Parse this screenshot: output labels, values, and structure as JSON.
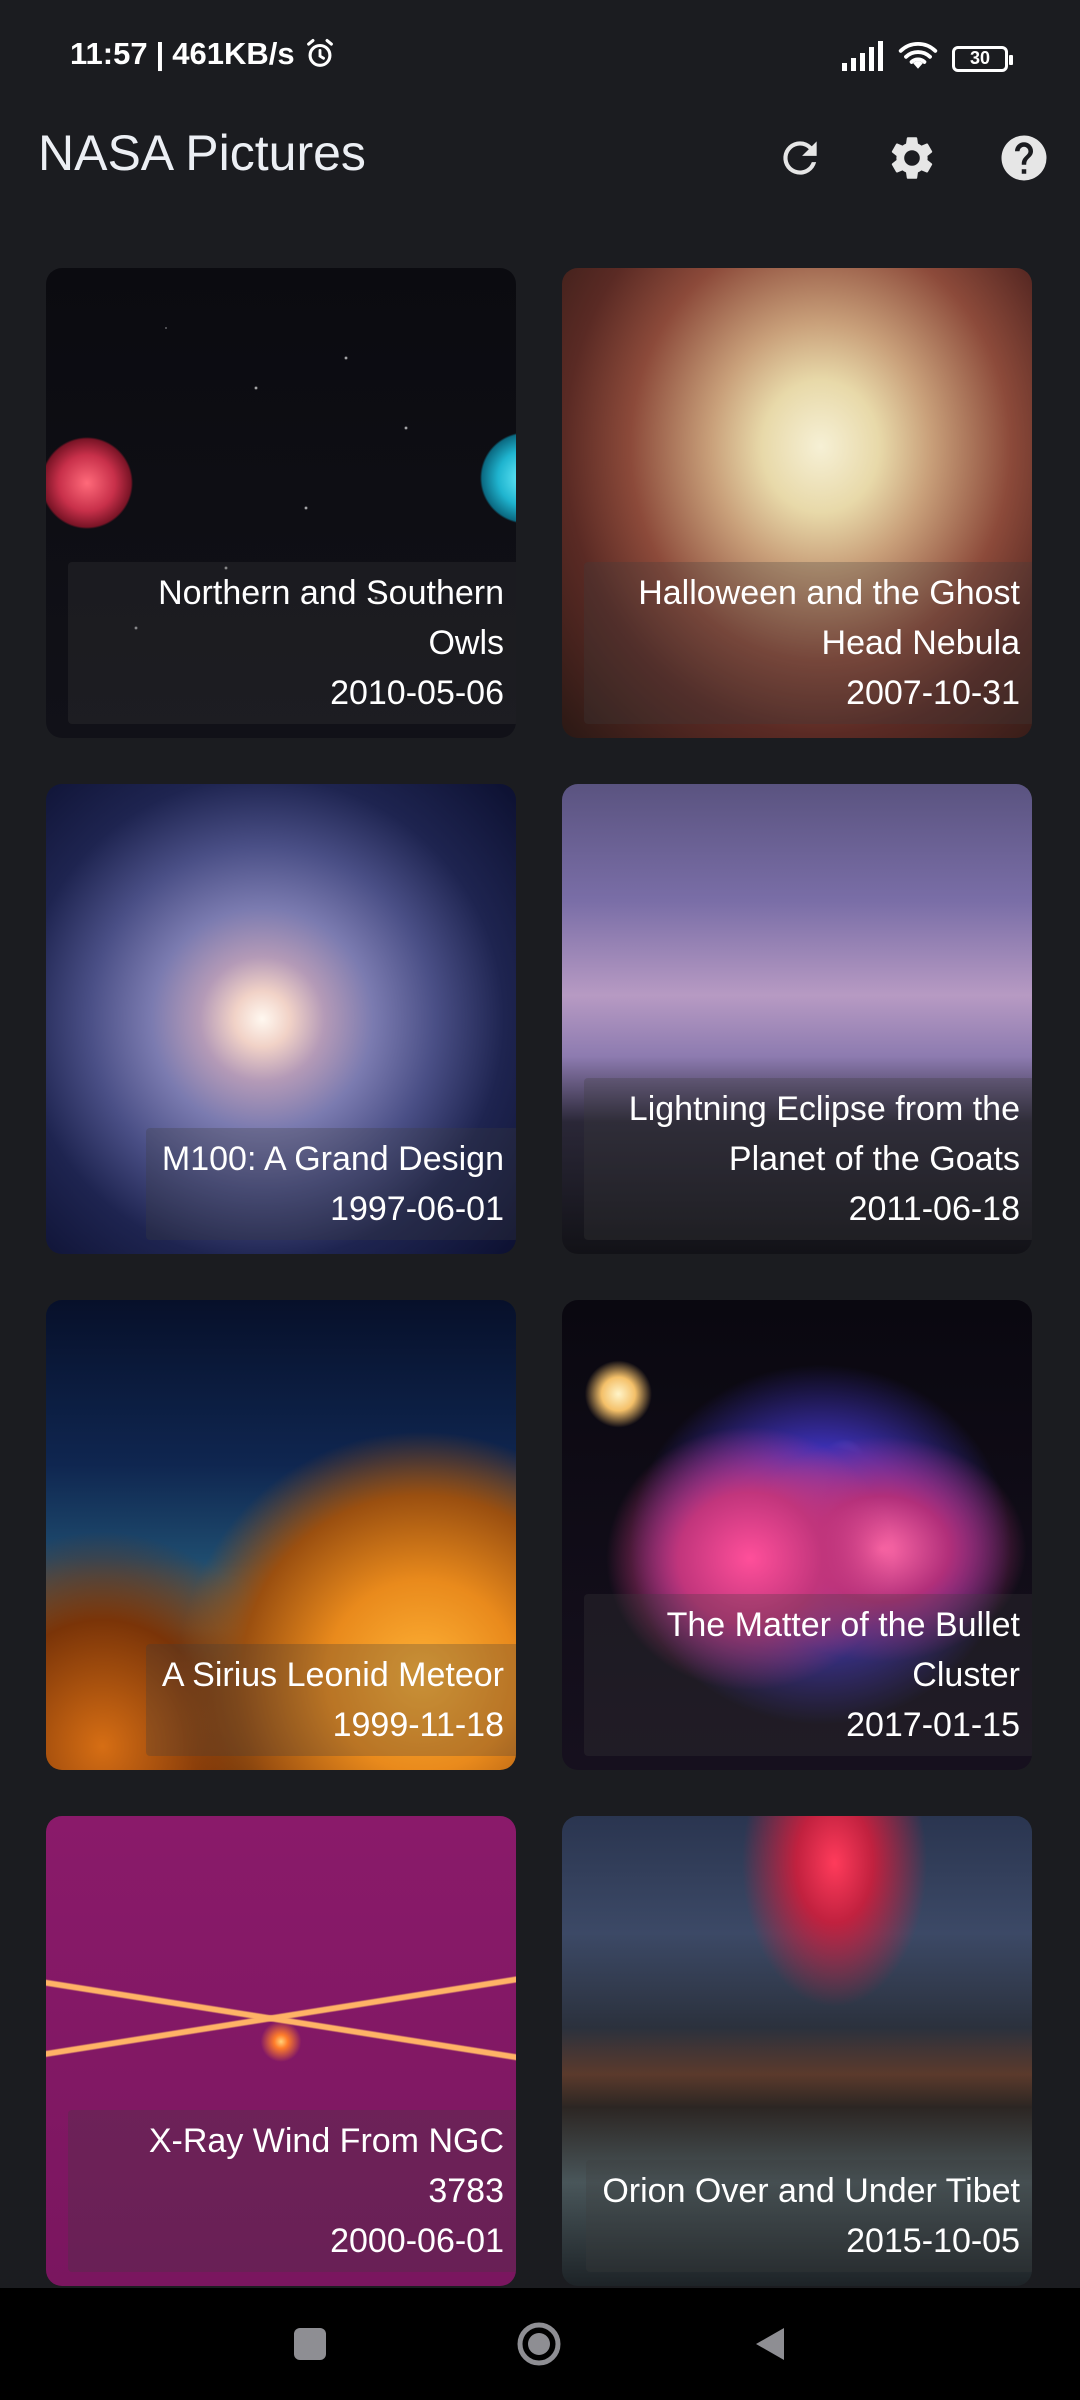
{
  "status_bar": {
    "time": "11:57",
    "network_speed": "461KB/s",
    "separator": "|",
    "battery_level": "30",
    "icons": [
      "alarm-icon",
      "signal-icon",
      "wifi-icon",
      "battery-icon"
    ]
  },
  "app_bar": {
    "title": "NASA Pictures",
    "actions": [
      {
        "name": "refresh-button",
        "icon": "refresh-icon"
      },
      {
        "name": "settings-button",
        "icon": "gear-icon"
      },
      {
        "name": "help-button",
        "icon": "help-icon"
      }
    ]
  },
  "pictures": [
    {
      "title": "Northern and Southern Owls",
      "date": "2010-05-06"
    },
    {
      "title": "Halloween and the Ghost Head Nebula",
      "date": "2007-10-31"
    },
    {
      "title": "M100: A Grand Design",
      "date": "1997-06-01"
    },
    {
      "title": "Lightning Eclipse from the Planet of the Goats",
      "date": "2011-06-18"
    },
    {
      "title": "A Sirius Leonid Meteor",
      "date": "1999-11-18"
    },
    {
      "title": "The Matter of the Bullet Cluster",
      "date": "2017-01-15"
    },
    {
      "title": "X-Ray Wind From NGC 3783",
      "date": "2000-06-01"
    },
    {
      "title": "Orion Over and Under Tibet",
      "date": "2015-10-05"
    }
  ],
  "navigation_bar": {
    "icons": [
      "recent-apps-icon",
      "home-icon",
      "back-icon"
    ]
  },
  "colors": {
    "background": "#1b1c20",
    "text": "#ffffff",
    "nav_background": "#000000"
  }
}
